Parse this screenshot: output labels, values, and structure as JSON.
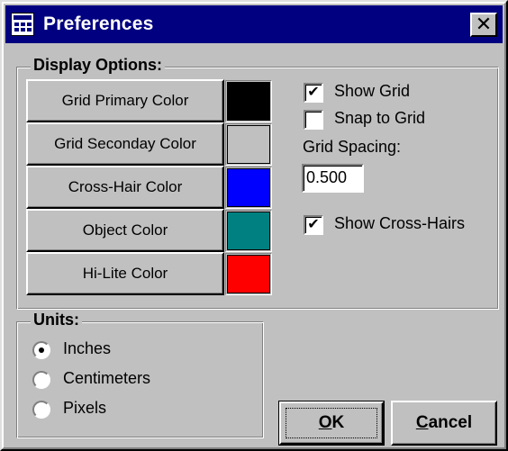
{
  "window": {
    "title": "Preferences",
    "close_glyph": "✕"
  },
  "display_options": {
    "label": "Display Options:",
    "color_buttons": [
      {
        "label": "Grid Primary Color",
        "color": "#000000"
      },
      {
        "label": "Grid Seconday Color",
        "color": "#c0c0c0"
      },
      {
        "label": "Cross-Hair Color",
        "color": "#0000ff"
      },
      {
        "label": "Object Color",
        "color": "#008080"
      },
      {
        "label": "Hi-Lite Color",
        "color": "#ff0000"
      }
    ],
    "show_grid": {
      "label": "Show Grid",
      "checked": true
    },
    "snap_to_grid": {
      "label": "Snap to Grid",
      "checked": false
    },
    "grid_spacing": {
      "label": "Grid Spacing:",
      "value": "0.500"
    },
    "show_cross_hairs": {
      "label": "Show Cross-Hairs",
      "checked": true
    },
    "check_glyph": "✔"
  },
  "units": {
    "label": "Units:",
    "options": [
      {
        "label": "Inches",
        "selected": true
      },
      {
        "label": "Centimeters",
        "selected": false
      },
      {
        "label": "Pixels",
        "selected": false
      }
    ]
  },
  "buttons": {
    "ok": {
      "mnemonic": "O",
      "rest": "K"
    },
    "cancel": {
      "mnemonic": "C",
      "rest": "ancel"
    }
  },
  "icons": {
    "app": "spreadsheet-app-icon",
    "close": "close-icon"
  }
}
